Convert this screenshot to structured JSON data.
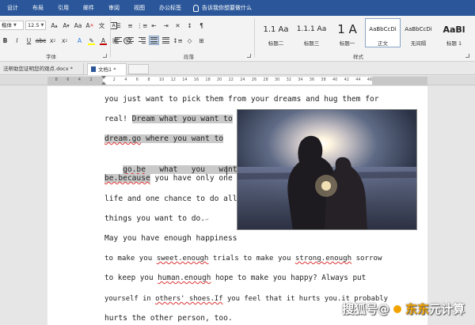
{
  "ribbon": {
    "tabs": [
      "设计",
      "布局",
      "引用",
      "邮件",
      "审阅",
      "视图",
      "办公标签"
    ],
    "active_tab": "办公标签",
    "tell_me": "告诉我你想要做什么",
    "font": {
      "name": "楷体",
      "size": "12.5"
    },
    "group_font": "字体",
    "group_paragraph": "段落",
    "group_styles": "样式",
    "font_color": "#c00000",
    "highlight_color": "#ffff00",
    "styles": [
      {
        "sample": "1.1 Aa",
        "name": "标题二"
      },
      {
        "sample": "1.1.1 Aa",
        "name": "标题三"
      },
      {
        "sample": "1 A",
        "name": "标题一"
      },
      {
        "sample": "AaBbCcDi",
        "name": "正文"
      },
      {
        "sample": "AaBbCcDi",
        "name": "无间隔"
      },
      {
        "sample": "AaBl",
        "name": "标题 1"
      }
    ]
  },
  "doc_tabs": {
    "tab1": "法帮助您证明您的观点.docx *",
    "tab2": "文档1 *"
  },
  "ruler": {
    "left_numbers": [
      "8",
      "6",
      "4",
      "2"
    ],
    "right_numbers": [
      "2",
      "4",
      "6",
      "8",
      "10",
      "12",
      "14",
      "16",
      "18",
      "20",
      "22",
      "24",
      "26",
      "28",
      "30",
      "32",
      "34",
      "36",
      "38",
      "40",
      "42",
      "44",
      "46"
    ]
  },
  "document": {
    "l01": "you just want to pick them from your dreams and hug them for",
    "l02a": "real! ",
    "l02b": "Dream what you want to",
    "l03a": "dream.go",
    "l03b": " where you want to",
    "l04a": "go.be",
    "l04b": "   what   you   want   to",
    "l05a": "be.because",
    "l05b": " you have only one",
    "l06": "life and one chance to do all the",
    "l07": "things you want to do.",
    "l08": "May you have enough happiness",
    "l09a": "to make you ",
    "l09b": "sweet.enough",
    "l09c": " trials to make you ",
    "l09d": "strong.enough",
    "l09e": " sorrow",
    "l10a": "to keep you ",
    "l10b": "human.enough",
    "l10c": " hope to make you happy? Always put",
    "l11a": "yourself in ",
    "l11b": "others' shoes.If",
    "l11c": " you feel that it hurts you.it probably",
    "l12": "hurts the other person, too.",
    "enter_mark": "↵"
  },
  "watermark": {
    "prefix": "搜狐号@",
    "name": "东东",
    "suffix": "元计算"
  }
}
